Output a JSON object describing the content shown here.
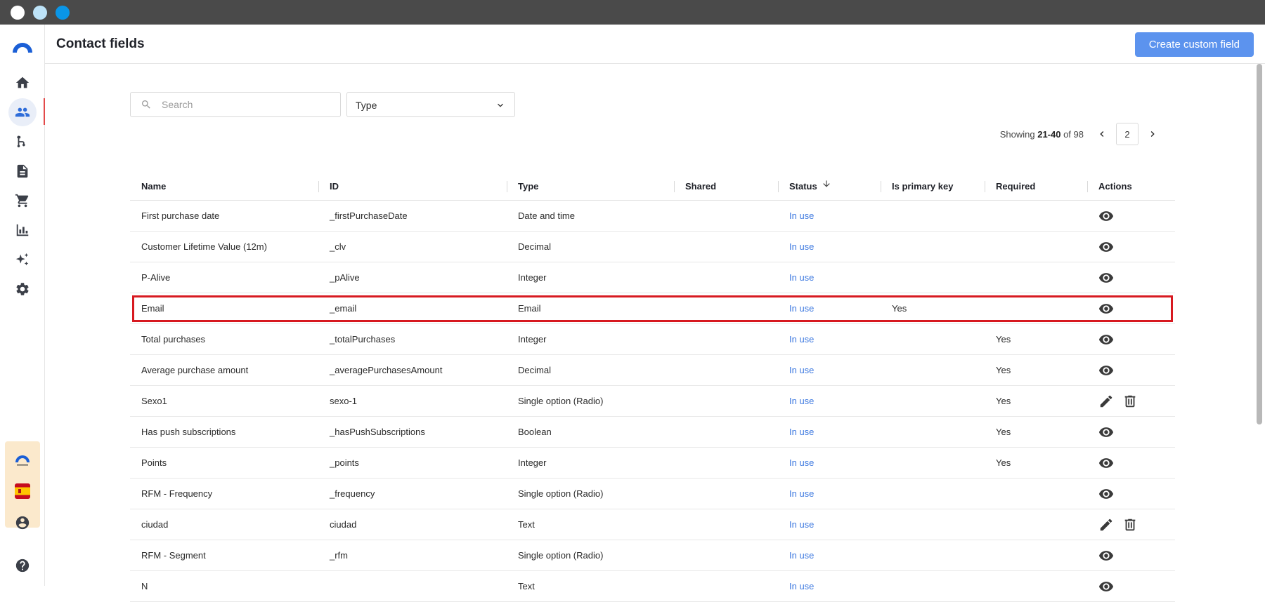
{
  "header": {
    "title": "Contact fields",
    "create_button": "Create custom field"
  },
  "sidebar": {
    "items": [
      {
        "name": "home-icon"
      },
      {
        "name": "contacts-icon",
        "active": true
      },
      {
        "name": "flows-icon"
      },
      {
        "name": "templates-icon"
      },
      {
        "name": "cart-icon"
      },
      {
        "name": "analytics-icon"
      },
      {
        "name": "ai-sparkle-icon"
      },
      {
        "name": "settings-icon"
      }
    ],
    "account_flag": "es-flag-icon",
    "user_icon": "account-icon",
    "help_icon": "help-icon"
  },
  "filters": {
    "search_placeholder": "Search",
    "type_label": "Type"
  },
  "pagination": {
    "prefix": "Showing ",
    "range": "21-40",
    "suffix": " of 98",
    "page": "2"
  },
  "table": {
    "columns": [
      "Name",
      "ID",
      "Type",
      "Shared",
      "Status",
      "Is primary key",
      "Required",
      "Actions"
    ],
    "rows": [
      {
        "name": "First purchase date",
        "id": "_firstPurchaseDate",
        "type": "Date and time",
        "shared": "",
        "status": "In use",
        "pk": "",
        "required": "",
        "actions": "view"
      },
      {
        "name": "Customer Lifetime Value (12m)",
        "id": "_clv",
        "type": "Decimal",
        "shared": "",
        "status": "In use",
        "pk": "",
        "required": "",
        "actions": "view"
      },
      {
        "name": "P-Alive",
        "id": "_pAlive",
        "type": "Integer",
        "shared": "",
        "status": "In use",
        "pk": "",
        "required": "",
        "actions": "view"
      },
      {
        "name": "Email",
        "id": "_email",
        "type": "Email",
        "shared": "",
        "status": "In use",
        "pk": "Yes",
        "required": "",
        "actions": "view",
        "highlight": true
      },
      {
        "name": "Total purchases",
        "id": "_totalPurchases",
        "type": "Integer",
        "shared": "",
        "status": "In use",
        "pk": "",
        "required": "Yes",
        "actions": "view"
      },
      {
        "name": "Average purchase amount",
        "id": "_averagePurchasesAmount",
        "type": "Decimal",
        "shared": "",
        "status": "In use",
        "pk": "",
        "required": "Yes",
        "actions": "view"
      },
      {
        "name": "Sexo1",
        "id": "sexo-1",
        "type": "Single option (Radio)",
        "shared": "",
        "status": "In use",
        "pk": "",
        "required": "Yes",
        "actions": "edit"
      },
      {
        "name": "Has push subscriptions",
        "id": "_hasPushSubscriptions",
        "type": "Boolean",
        "shared": "",
        "status": "In use",
        "pk": "",
        "required": "Yes",
        "actions": "view"
      },
      {
        "name": "Points",
        "id": "_points",
        "type": "Integer",
        "shared": "",
        "status": "In use",
        "pk": "",
        "required": "Yes",
        "actions": "view"
      },
      {
        "name": "RFM - Frequency",
        "id": "_frequency",
        "type": "Single option (Radio)",
        "shared": "",
        "status": "In use",
        "pk": "",
        "required": "",
        "actions": "view"
      },
      {
        "name": "ciudad",
        "id": "ciudad",
        "type": "Text",
        "shared": "",
        "status": "In use",
        "pk": "",
        "required": "",
        "actions": "edit"
      },
      {
        "name": "RFM - Segment",
        "id": "_rfm",
        "type": "Single option (Radio)",
        "shared": "",
        "status": "In use",
        "pk": "",
        "required": "",
        "actions": "view"
      },
      {
        "name": "N",
        "id": "",
        "type": "Text",
        "shared": "",
        "status": "In use",
        "pk": "",
        "required": "",
        "actions": "view"
      }
    ]
  }
}
